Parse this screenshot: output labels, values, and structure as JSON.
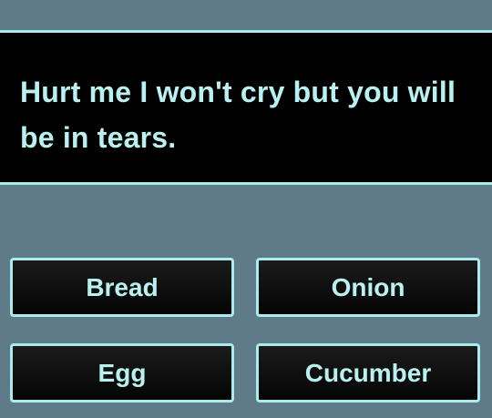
{
  "question": {
    "text": "Hurt me I won't cry but you will be in tears."
  },
  "answers": [
    {
      "label": "Bread"
    },
    {
      "label": "Onion"
    },
    {
      "label": "Egg"
    },
    {
      "label": "Cucumber"
    }
  ],
  "colors": {
    "background": "#5f7a88",
    "panel": "#000000",
    "accent": "#a9ecec",
    "text": "#b9f1f1"
  }
}
